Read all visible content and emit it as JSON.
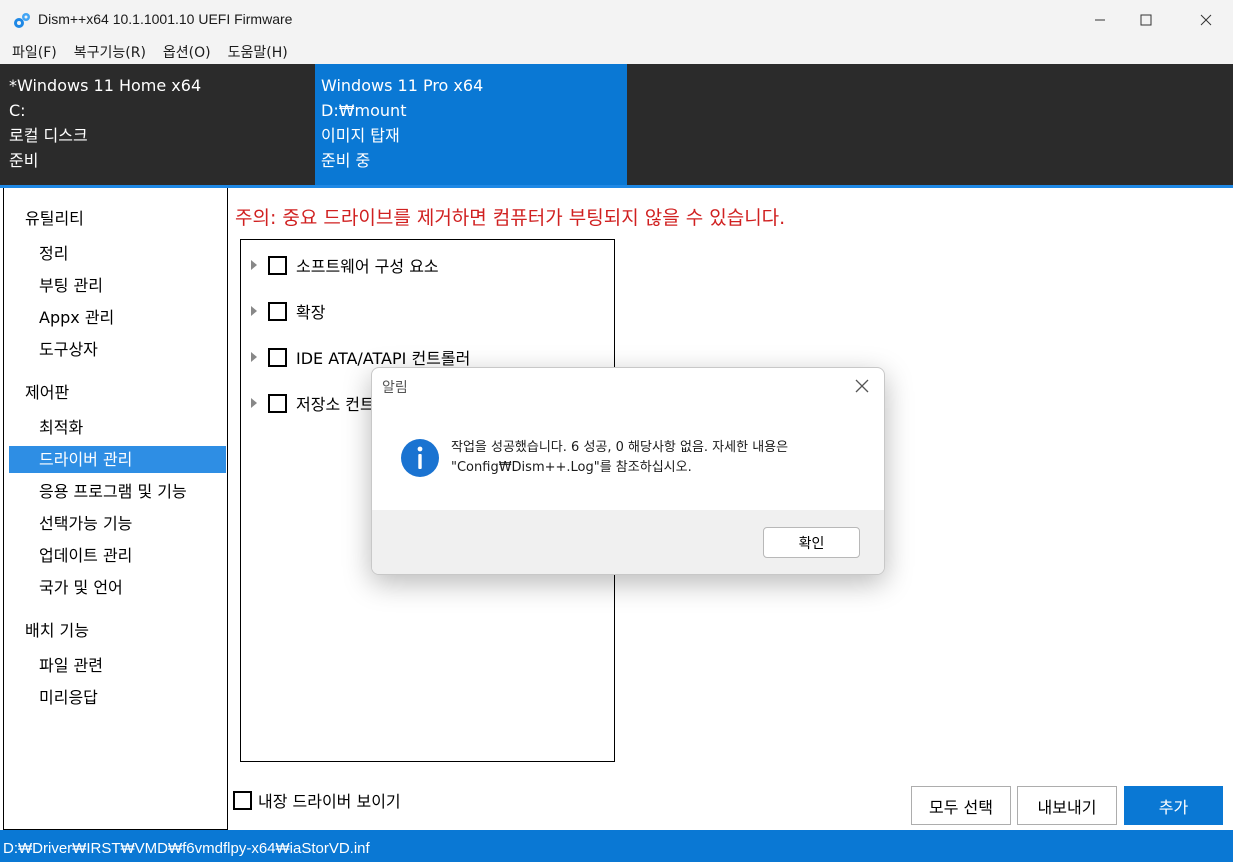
{
  "window": {
    "title": "Dism++x64 10.1.1001.10 UEFI Firmware"
  },
  "menu": {
    "items": [
      {
        "label": "파일(F)"
      },
      {
        "label": "복구기능(R)"
      },
      {
        "label": "옵션(O)"
      },
      {
        "label": "도움말(H)"
      }
    ]
  },
  "sessions": [
    {
      "name": "*Windows 11 Home x64",
      "path": "C:",
      "type": "로컬 디스크",
      "status": "준비"
    },
    {
      "name": "Windows 11 Pro x64",
      "path": "D:₩mount",
      "type": "이미지 탑재",
      "status": "준비 중"
    }
  ],
  "sidebar": {
    "groups": [
      {
        "label": "유틸리티",
        "items": [
          "정리",
          "부팅 관리",
          "Appx 관리",
          "도구상자"
        ]
      },
      {
        "label": "제어판",
        "items": [
          "최적화",
          "드라이버 관리",
          "응용 프로그램 및 기능",
          "선택가능 기능",
          "업데이트 관리",
          "국가 및 언어"
        ]
      },
      {
        "label": "배치 기능",
        "items": [
          "파일 관련",
          "미리응답"
        ]
      }
    ],
    "selected": "드라이버 관리"
  },
  "main": {
    "warning": "주의: 중요 드라이브를 제거하면 컴퓨터가 부팅되지 않을 수 있습니다.",
    "tree": [
      {
        "label": "소프트웨어 구성 요소"
      },
      {
        "label": "확장"
      },
      {
        "label": "IDE ATA/ATAPI 컨트롤러"
      },
      {
        "label": "저장소 컨트"
      }
    ],
    "show_builtin_label": "내장 드라이버 보이기",
    "buttons": {
      "select_all": "모두 선택",
      "export": "내보내기",
      "add": "추가"
    }
  },
  "statusbar": {
    "text": "D:₩Driver₩IRST₩VMD₩f6vmdflpy-x64₩iaStorVD.inf"
  },
  "dialog": {
    "title": "알림",
    "message_line1": "작업을 성공했습니다. 6 성공, 0 해당사항 없음. 자세한 내용은",
    "message_line2": "\"Config₩Dism++.Log\"를 참조하십시오.",
    "ok_label": "확인"
  },
  "colors": {
    "accent": "#0a78d4",
    "selection": "#2e8ee4",
    "warning": "#d02020",
    "band": "#2b2b2b"
  }
}
